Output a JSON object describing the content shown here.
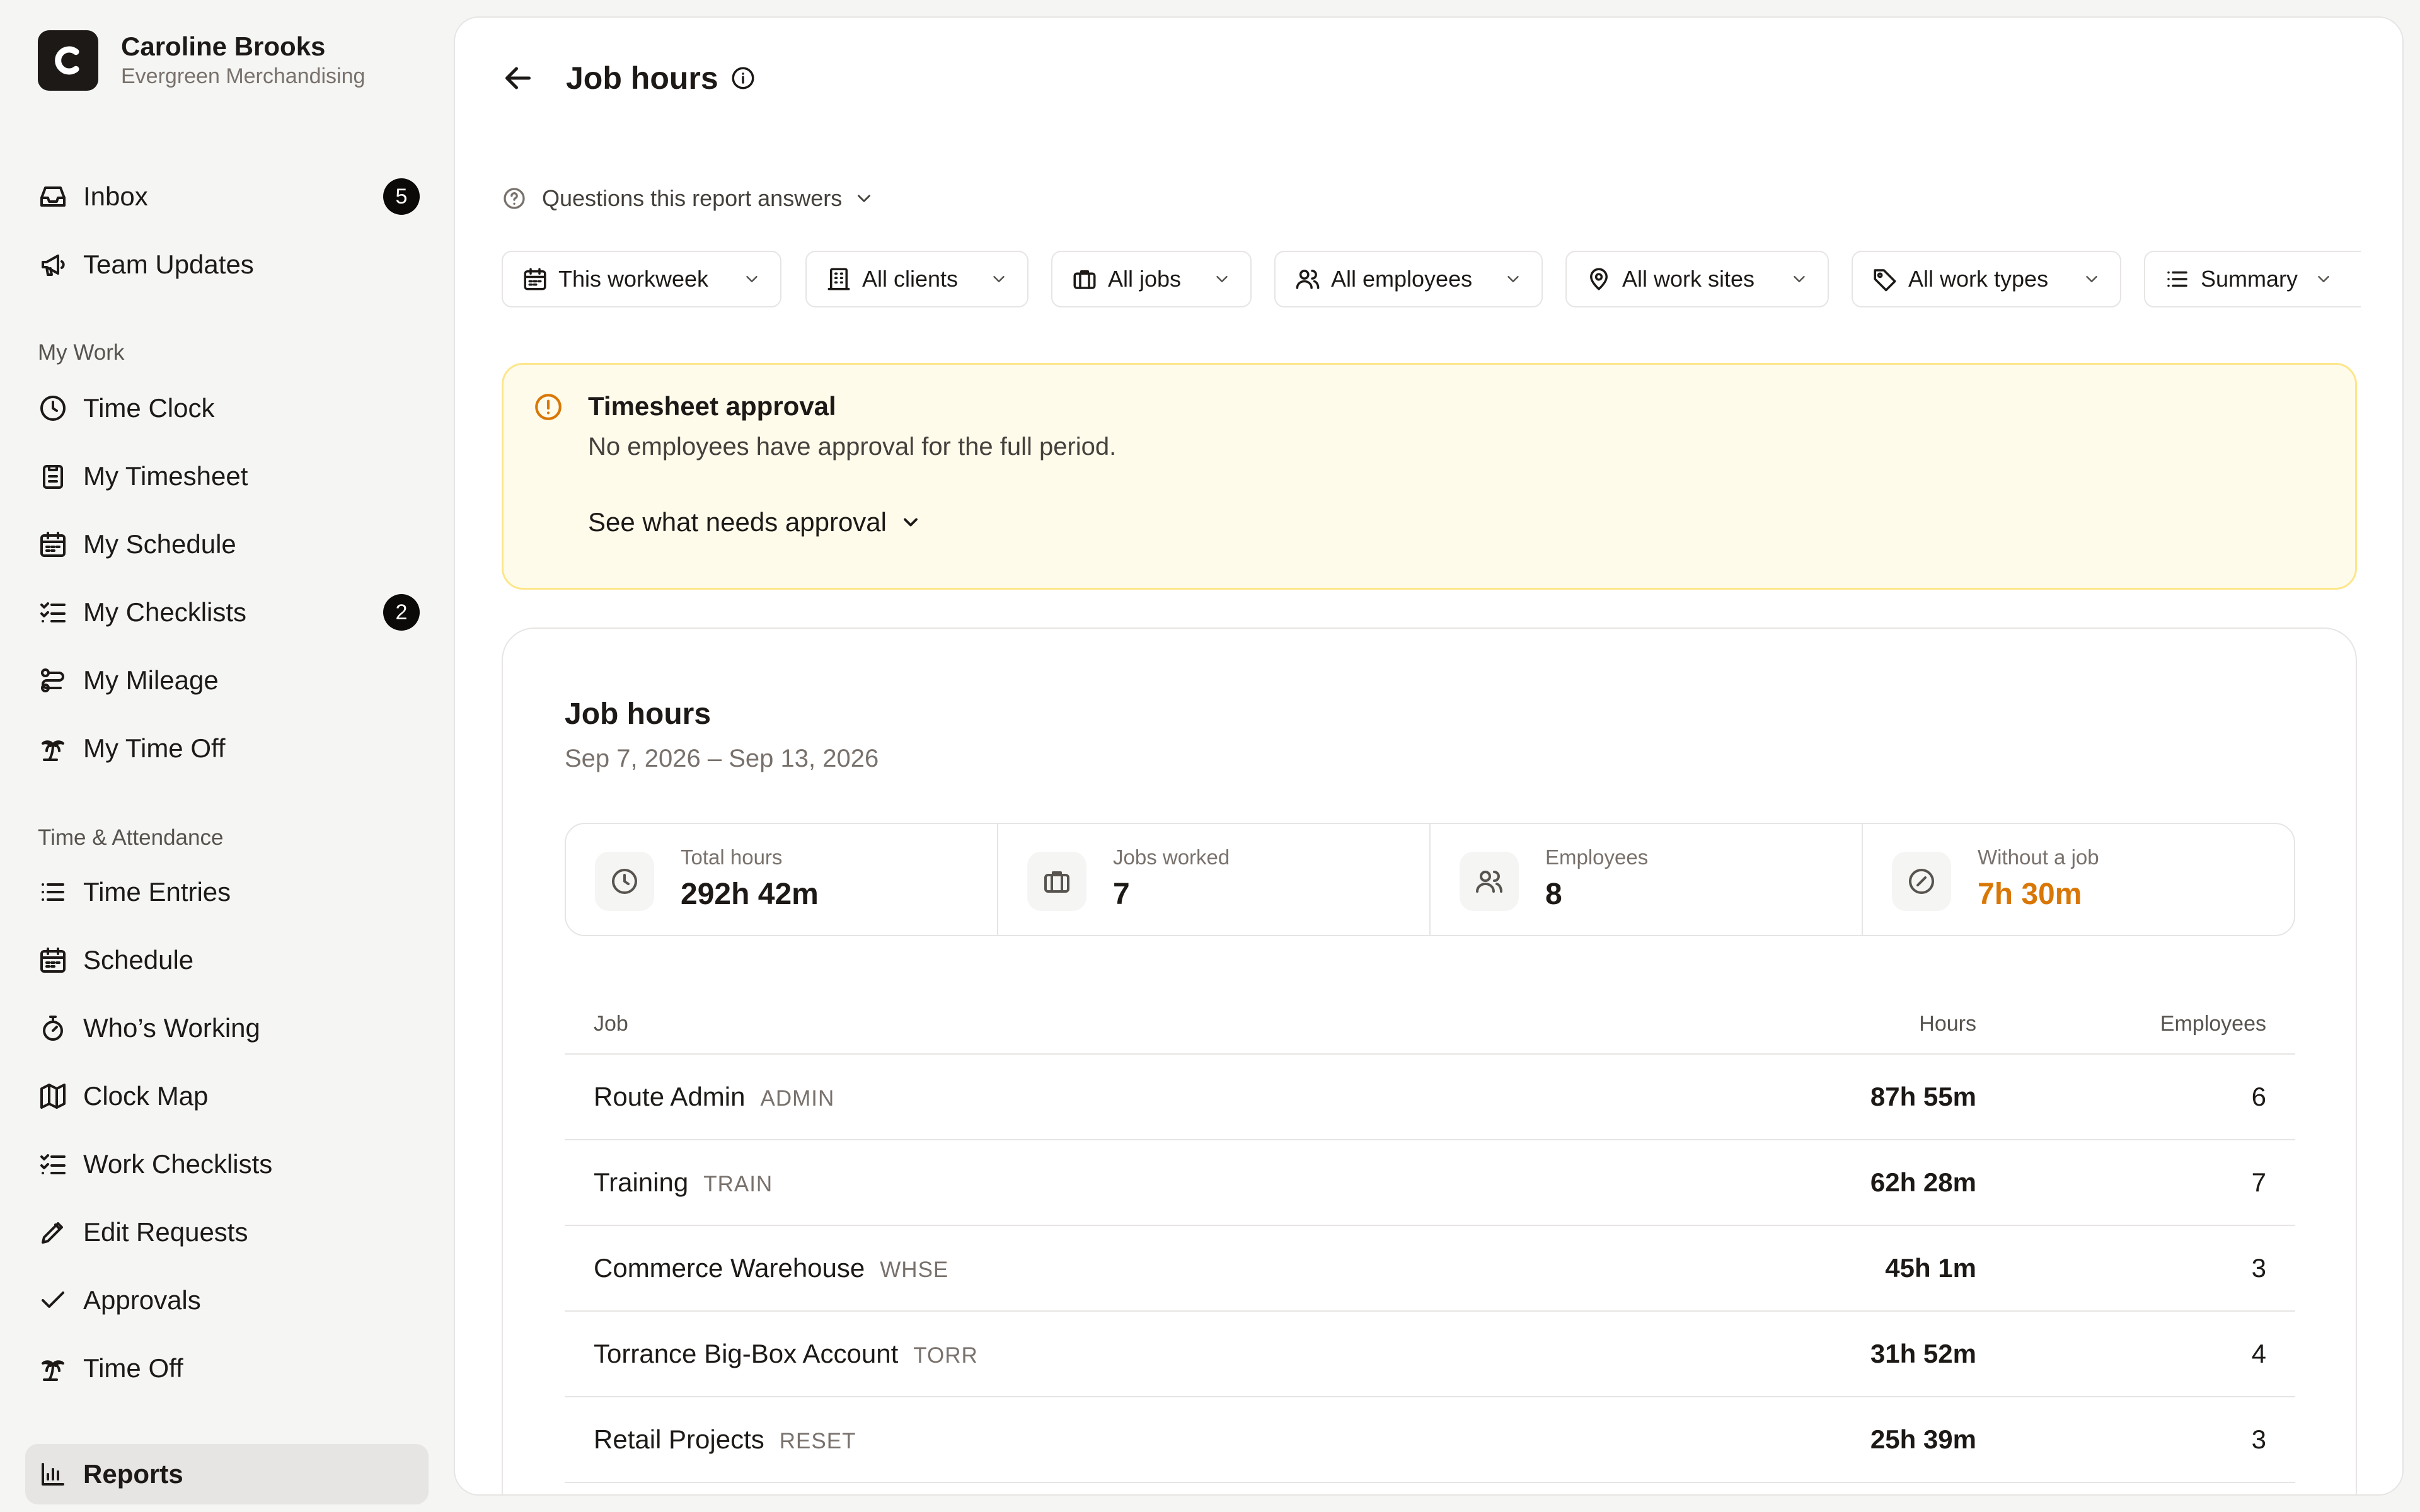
{
  "user": {
    "initial": "C",
    "name": "Caroline Brooks",
    "company": "Evergreen Merchandising"
  },
  "nav": {
    "top": [
      {
        "label": "Inbox",
        "icon": "inbox-icon",
        "badge": "5"
      },
      {
        "label": "Team Updates",
        "icon": "megaphone-icon"
      }
    ],
    "my_work_label": "My Work",
    "my_work": [
      {
        "label": "Time Clock",
        "icon": "clock-icon"
      },
      {
        "label": "My Timesheet",
        "icon": "clipboard-icon"
      },
      {
        "label": "My Schedule",
        "icon": "calendar-icon"
      },
      {
        "label": "My Checklists",
        "icon": "checklist-icon",
        "badge": "2"
      },
      {
        "label": "My Mileage",
        "icon": "route-icon"
      },
      {
        "label": "My Time Off",
        "icon": "palm-tree-icon"
      }
    ],
    "time_attendance_label": "Time & Attendance",
    "time_attendance": [
      {
        "label": "Time Entries",
        "icon": "list-icon"
      },
      {
        "label": "Schedule",
        "icon": "calendar-icon"
      },
      {
        "label": "Who’s Working",
        "icon": "stopwatch-icon"
      },
      {
        "label": "Clock Map",
        "icon": "map-icon"
      },
      {
        "label": "Work Checklists",
        "icon": "checklist-icon"
      },
      {
        "label": "Edit Requests",
        "icon": "pencil-icon"
      },
      {
        "label": "Approvals",
        "icon": "check-icon"
      },
      {
        "label": "Time Off",
        "icon": "palm-tree-icon"
      }
    ],
    "reports": {
      "label": "Reports",
      "icon": "bar-chart-icon"
    }
  },
  "header": {
    "title": "Job hours"
  },
  "questions_label": "Questions this report answers",
  "filters": [
    {
      "label": "This workweek",
      "icon": "calendar-icon"
    },
    {
      "label": "All clients",
      "icon": "building-icon"
    },
    {
      "label": "All jobs",
      "icon": "briefcase-icon"
    },
    {
      "label": "All employees",
      "icon": "users-icon"
    },
    {
      "label": "All work sites",
      "icon": "map-pin-icon"
    },
    {
      "label": "All work types",
      "icon": "tag-icon"
    },
    {
      "label": "Summary",
      "icon": "list-icon"
    }
  ],
  "alert": {
    "title": "Timesheet approval",
    "text": "No employees have approval for the full period.",
    "link": "See what needs approval",
    "color": "#d97706"
  },
  "report": {
    "title": "Job hours",
    "range": "Sep 7, 2026 – Sep 13, 2026",
    "stats": [
      {
        "label": "Total hours",
        "value": "292h 42m",
        "icon": "clock-icon"
      },
      {
        "label": "Jobs worked",
        "value": "7",
        "icon": "briefcase-icon"
      },
      {
        "label": "Employees",
        "value": "8",
        "icon": "users-icon"
      },
      {
        "label": "Without a job",
        "value": "7h 30m",
        "icon": "no-job-icon",
        "warn": true
      }
    ],
    "columns": {
      "job": "Job",
      "hours": "Hours",
      "employees": "Employees"
    },
    "rows": [
      {
        "name": "Route Admin",
        "code": "ADMIN",
        "hours": "87h 55m",
        "employees": "6"
      },
      {
        "name": "Training",
        "code": "TRAIN",
        "hours": "62h 28m",
        "employees": "7"
      },
      {
        "name": "Commerce Warehouse",
        "code": "WHSE",
        "hours": "45h 1m",
        "employees": "3"
      },
      {
        "name": "Torrance Big-Box Account",
        "code": "TORR",
        "hours": "31h 52m",
        "employees": "4"
      },
      {
        "name": "Retail Projects",
        "code": "RESET",
        "hours": "25h 39m",
        "employees": "3"
      }
    ]
  }
}
